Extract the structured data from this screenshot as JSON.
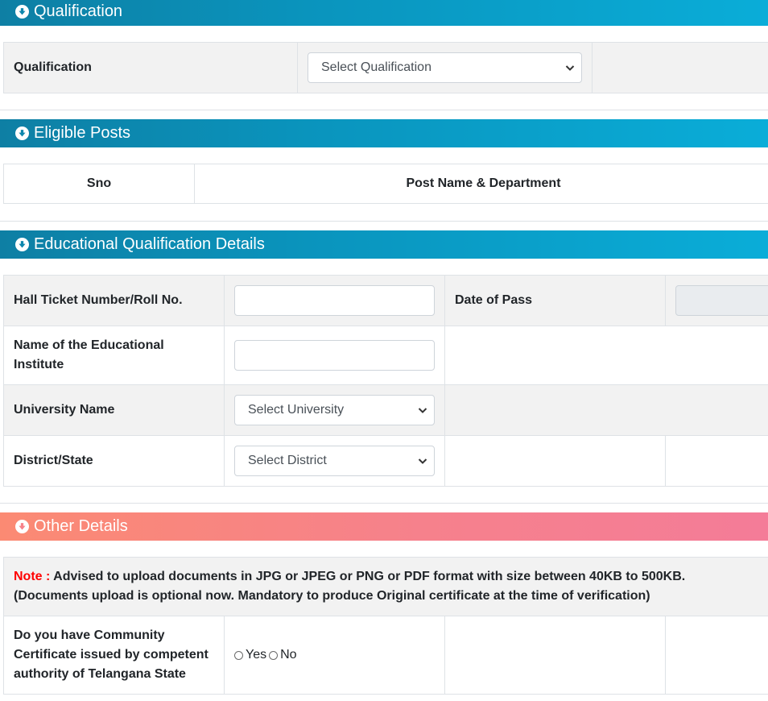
{
  "sections": {
    "qualification": {
      "title": "Qualification"
    },
    "eligible_posts": {
      "title": "Eligible Posts"
    },
    "education": {
      "title": "Educational Qualification Details"
    },
    "other": {
      "title": "Other Details"
    }
  },
  "qualification": {
    "label": "Qualification",
    "select_value": "Select Qualification"
  },
  "eligible_posts": {
    "columns": [
      "Sno",
      "Post Name & Department"
    ]
  },
  "education": {
    "hall_ticket_label": "Hall Ticket Number/Roll No.",
    "hall_ticket_value": "",
    "date_of_pass_label": "Date of Pass",
    "date_of_pass_value": "",
    "institute_label": "Name of the Educational Institute",
    "institute_value": "",
    "university_label": "University Name",
    "university_select": "Select University",
    "district_label": "District/State",
    "district_select": "Select District"
  },
  "other": {
    "note_prefix": "Note :",
    "note_text": " Advised to upload documents in JPG or JPEG or PNG or PDF format with size between 40KB to 500KB.",
    "note_line2": "(Documents upload is optional now. Mandatory to produce Original certificate at the time of verification)",
    "community_label": "Do you have Community Certificate issued by competent authority of Telangana State",
    "option_yes": "Yes",
    "option_no": "No"
  },
  "colors": {
    "header_blue": "#0a94bd",
    "header_pink": "#f6818c",
    "note_red": "#ff0000"
  },
  "icons": {
    "section_toggle": "circle-chevron-down-icon",
    "select_caret": "chevron-down-icon"
  }
}
